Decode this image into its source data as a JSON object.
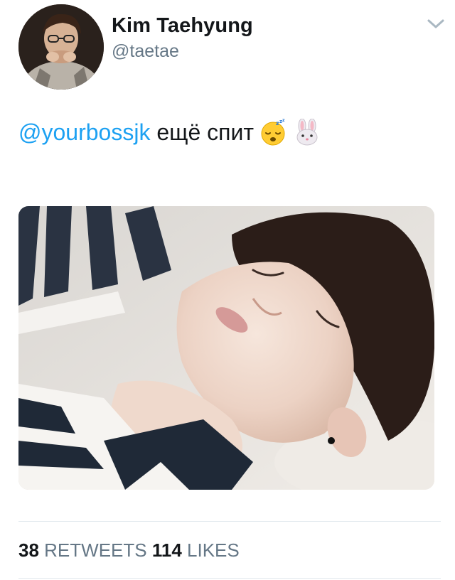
{
  "tweet": {
    "display_name": "Kim Taehyung",
    "handle": "@taetae",
    "mention": "@yourbossjk",
    "text": "ещё спит",
    "emojis": [
      "sleeping-face-icon",
      "rabbit-face-icon"
    ],
    "image": "photo-sleeping-person"
  },
  "stats": {
    "retweets_count": "38",
    "retweets_label": "RETWEETS",
    "likes_count": "114",
    "likes_label": "LIKES"
  },
  "colors": {
    "link": "#1da1f2",
    "secondary_text": "#657786",
    "primary_text": "#14171a",
    "divider": "#e1e8ed"
  }
}
